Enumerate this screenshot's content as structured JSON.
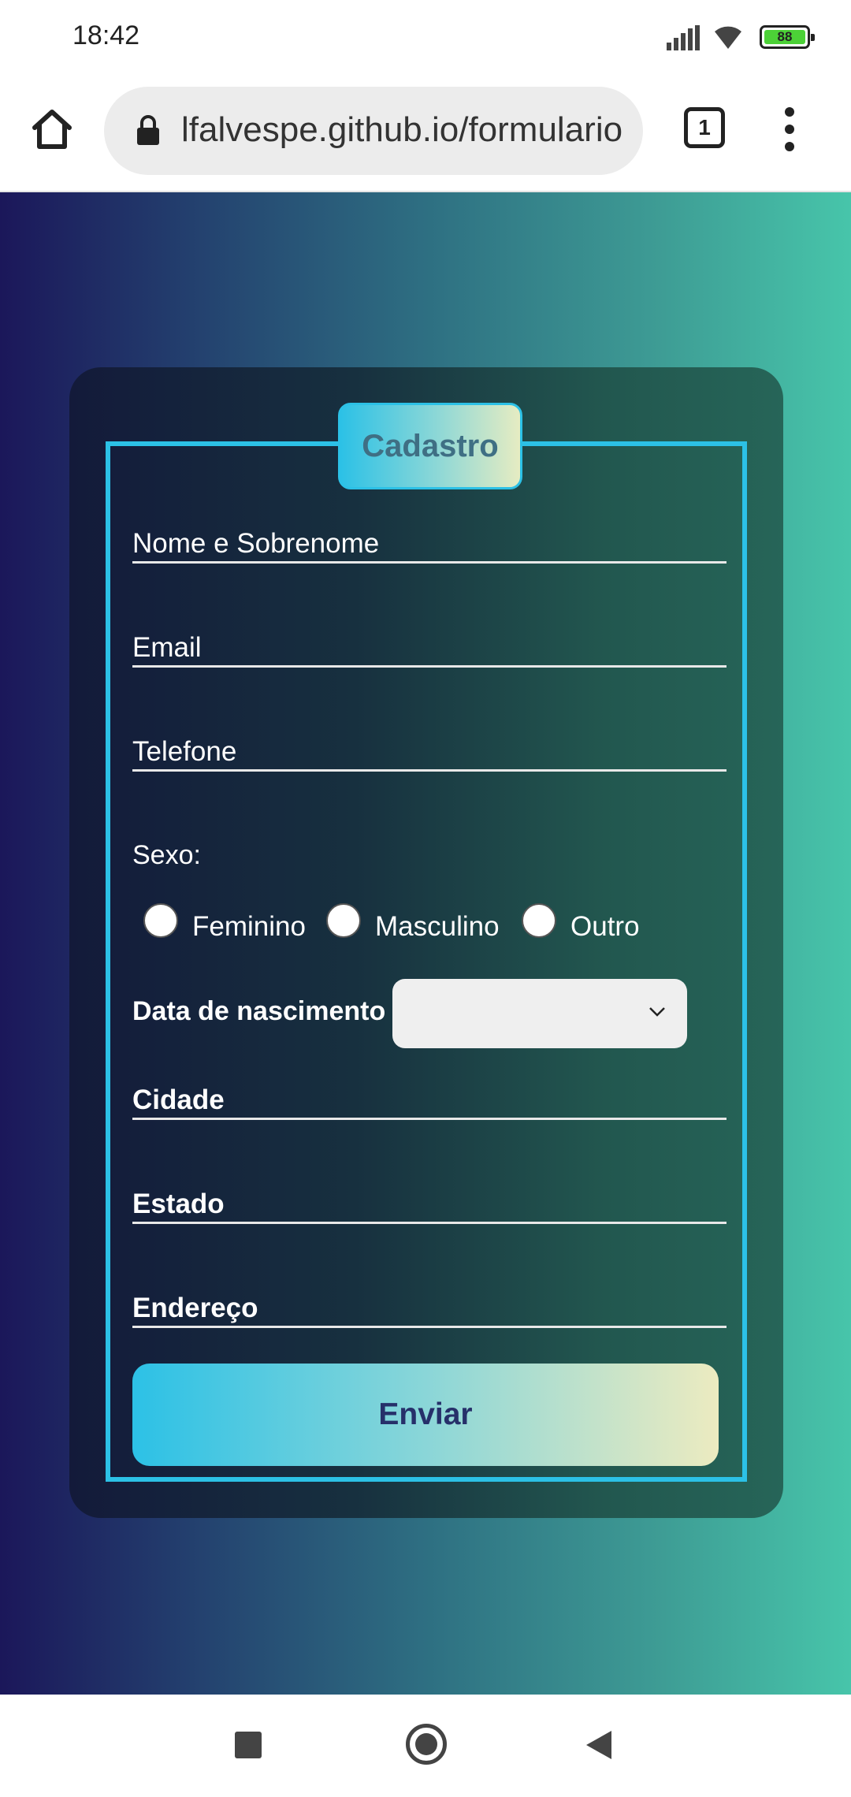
{
  "status_bar": {
    "time": "18:42",
    "battery_level": "88",
    "icons": [
      "signal-icon",
      "wifi-icon",
      "battery-icon"
    ]
  },
  "browser": {
    "url": "lfalvespe.github.io/formulario",
    "tab_count": "1",
    "icons": [
      "home-icon",
      "lock-icon",
      "tabs-icon",
      "menu-icon"
    ]
  },
  "form": {
    "legend": "Cadastro",
    "fields": {
      "name_placeholder": "Nome e Sobrenome",
      "email_placeholder": "Email",
      "phone_placeholder": "Telefone",
      "city_label": "Cidade",
      "state_label": "Estado",
      "address_label": "Endereço"
    },
    "sexo": {
      "label": "Sexo:",
      "options": [
        "Feminino",
        "Masculino",
        "Outro"
      ]
    },
    "birth_label": "Data de nascimento",
    "birth_value": "",
    "submit_label": "Enviar"
  },
  "colors": {
    "accent": "#2cc1e6",
    "button_text": "#26306a",
    "legend_text": "#3f6f84"
  },
  "nav_bar": {
    "icons": [
      "recents-icon",
      "home-circle-icon",
      "back-icon"
    ]
  }
}
